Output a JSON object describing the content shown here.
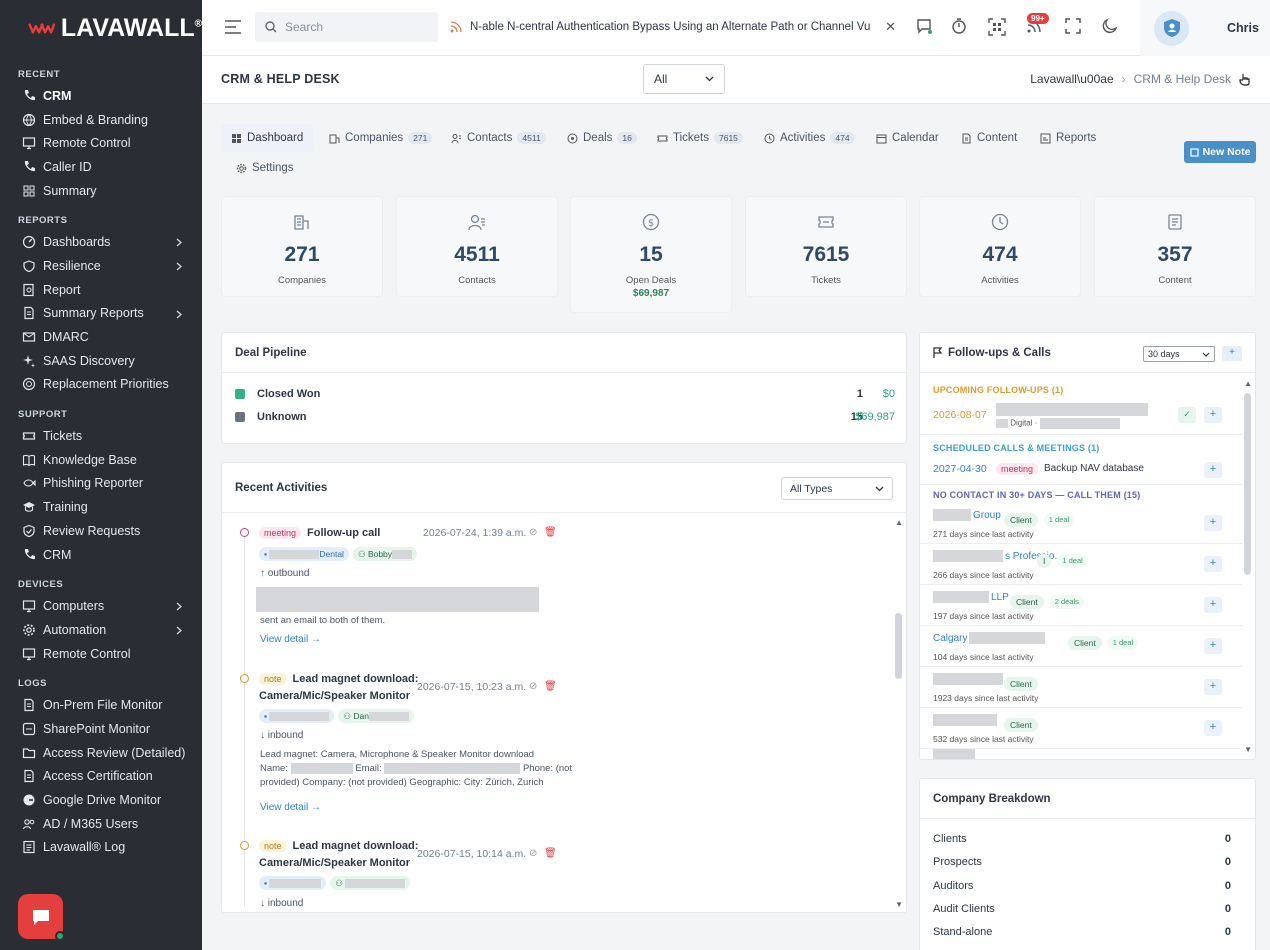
{
  "brand": {
    "name": "LAVAWALL",
    "reg": "®"
  },
  "sidebar": {
    "sections": [
      {
        "title": "RECENT",
        "items": [
          {
            "label": "CRM",
            "icon": "phone-icon",
            "active": true
          },
          {
            "label": "Embed & Branding",
            "icon": "globe-icon"
          },
          {
            "label": "Remote Control",
            "icon": "monitor-icon"
          },
          {
            "label": "Caller ID",
            "icon": "phone-icon"
          },
          {
            "label": "Summary",
            "icon": "grid-icon"
          }
        ]
      },
      {
        "title": "REPORTS",
        "items": [
          {
            "label": "Dashboards",
            "icon": "gauge-icon",
            "chev": true
          },
          {
            "label": "Resilience",
            "icon": "heart-shield-icon",
            "chev": true
          },
          {
            "label": "Report",
            "icon": "search-doc-icon"
          },
          {
            "label": "Summary Reports",
            "icon": "doc-icon",
            "chev": true
          },
          {
            "label": "DMARC",
            "icon": "mail-check-icon"
          },
          {
            "label": "SAAS Discovery",
            "icon": "sparkle-icon"
          },
          {
            "label": "Replacement Priorities",
            "icon": "target-icon"
          }
        ]
      },
      {
        "title": "SUPPORT",
        "items": [
          {
            "label": "Tickets",
            "icon": "ticket-icon"
          },
          {
            "label": "Knowledge Base",
            "icon": "book-icon"
          },
          {
            "label": "Phishing Reporter",
            "icon": "fish-icon"
          },
          {
            "label": "Training",
            "icon": "cap-icon"
          },
          {
            "label": "Review Requests",
            "icon": "shield-check-icon"
          },
          {
            "label": "CRM",
            "icon": "phone-icon"
          }
        ]
      },
      {
        "title": "DEVICES",
        "items": [
          {
            "label": "Computers",
            "icon": "monitor-icon",
            "chev": true
          },
          {
            "label": "Automation",
            "icon": "cog-icon",
            "chev": true
          },
          {
            "label": "Remote Control",
            "icon": "monitor-icon"
          }
        ]
      },
      {
        "title": "LOGS",
        "items": [
          {
            "label": "On-Prem File Monitor",
            "icon": "doc-icon"
          },
          {
            "label": "SharePoint Monitor",
            "icon": "share-icon"
          },
          {
            "label": "Access Review (Detailed)",
            "icon": "folder-icon"
          },
          {
            "label": "Access Certification",
            "icon": "doc-icon"
          },
          {
            "label": "Google Drive Monitor",
            "icon": "google-icon"
          },
          {
            "label": "AD / M365 Users",
            "icon": "users-icon"
          },
          {
            "label": "Lavawall® Log",
            "icon": "log-icon"
          }
        ]
      }
    ]
  },
  "topbar": {
    "search_placeholder": "Search",
    "ticker": "N-able N-central Authentication Bypass Using an Alternate Path or Channel Vulnerability",
    "badge": "99+",
    "user": "Chris"
  },
  "header": {
    "title": "CRM & HELP DESK",
    "select": "All",
    "crumb1": "Lavawall\\u00ae",
    "crumb2": "CRM & Help Desk"
  },
  "tabs": [
    {
      "label": "Dashboard",
      "icon": "dashboard-icon",
      "active": true
    },
    {
      "label": "Companies",
      "count": "271",
      "icon": "building-icon"
    },
    {
      "label": "Contacts",
      "count": "4511",
      "icon": "contacts-icon"
    },
    {
      "label": "Deals",
      "count": "16",
      "icon": "deal-icon"
    },
    {
      "label": "Tickets",
      "count": "7615",
      "icon": "ticket-icon"
    },
    {
      "label": "Activities",
      "count": "474",
      "icon": "clock-icon"
    },
    {
      "label": "Calendar",
      "icon": "calendar-icon"
    },
    {
      "label": "Content",
      "icon": "doc-icon"
    },
    {
      "label": "Reports",
      "icon": "report-icon"
    },
    {
      "label": "Settings",
      "icon": "gear-icon"
    }
  ],
  "new_note": "New Note",
  "stats": [
    {
      "num": "271",
      "label": "Companies",
      "icon": "building-icon"
    },
    {
      "num": "4511",
      "label": "Contacts",
      "icon": "contacts-icon"
    },
    {
      "num": "15",
      "label": "Open Deals",
      "sub": "$69,987",
      "icon": "dollar-icon"
    },
    {
      "num": "7615",
      "label": "Tickets",
      "icon": "ticket-icon"
    },
    {
      "num": "474",
      "label": "Activities",
      "icon": "clock-icon"
    },
    {
      "num": "357",
      "label": "Content",
      "icon": "doc-icon"
    }
  ],
  "pipeline": {
    "title": "Deal Pipeline",
    "rows": [
      {
        "label": "Closed Won",
        "count": "1",
        "amount": "$0",
        "color": "#2fb380"
      },
      {
        "label": "Unknown",
        "count": "15",
        "amount": "$69,987",
        "color": "#6b7280"
      }
    ]
  },
  "activities": {
    "title": "Recent Activities",
    "filter": "All Types",
    "items": [
      {
        "type": "meeting",
        "title": "Follow-up call",
        "title2": "",
        "date": "2026-07-24, 1:39 a.m.",
        "company": "Dental",
        "contact": "Bobby",
        "dir": "↑ outbound",
        "text": "sent an email to both of them.",
        "link": "View detail →"
      },
      {
        "type": "note",
        "title": "Lead magnet download:",
        "title2": "Camera/Mic/Speaker Monitor",
        "date": "2026-07-15, 10:23 a.m.",
        "company": "",
        "contact": "Dan",
        "dir": "↓ inbound",
        "text1": "Lead magnet: Camera, Microphone & Speaker Monitor download",
        "text2a": "Name:",
        "text2b": "Email:",
        "text2c": "Phone: (not",
        "text3": "provided) Company: (not provided) Geographic: City: Zürich, Zurich",
        "link": "View detail →"
      },
      {
        "type": "note",
        "title": "Lead magnet download:",
        "title2": "Camera/Mic/Speaker Monitor",
        "date": "2026-07-15, 10:14 a.m.",
        "company": "",
        "contact": "",
        "dir": "↓ inbound"
      }
    ]
  },
  "followups": {
    "title": "Follow-ups & Calls",
    "range": "30 days",
    "upcoming": {
      "title": "UPCOMING FOLLOW-UPS (1)",
      "date": "2026-08-07",
      "sub": "Digital ·"
    },
    "scheduled": {
      "title": "SCHEDULED CALLS & MEETINGS (1)",
      "date": "2027-04-30",
      "tag": "meeting",
      "text": "Backup NAV database"
    },
    "nocontact": {
      "title": "NO CONTACT IN 30+ DAYS — CALL THEM (15)",
      "rows": [
        {
          "name": "Group",
          "tag": "Client",
          "deals": "1 deal",
          "since": "271 days since last activity"
        },
        {
          "name": "s Professio...",
          "tag": "I",
          "deals": "1 deal",
          "since": "266 days since last activity"
        },
        {
          "name": "LLP",
          "tag": "Client",
          "deals": "2 deals",
          "since": "197 days since last activity"
        },
        {
          "name": "Calgary",
          "tag": "Client",
          "deals": "1 deal",
          "since": "104 days since last activity"
        },
        {
          "name": "",
          "tag": "Client",
          "deals": "",
          "since": "1923 days since last activity"
        },
        {
          "name": "",
          "tag": "Client",
          "deals": "",
          "since": "532 days since last activity"
        }
      ]
    }
  },
  "breakdown": {
    "title": "Company Breakdown",
    "rows": [
      {
        "label": "Clients",
        "value": "0"
      },
      {
        "label": "Prospects",
        "value": "0"
      },
      {
        "label": "Auditors",
        "value": "0"
      },
      {
        "label": "Audit Clients",
        "value": "0"
      },
      {
        "label": "Stand-alone",
        "value": "0"
      }
    ]
  }
}
